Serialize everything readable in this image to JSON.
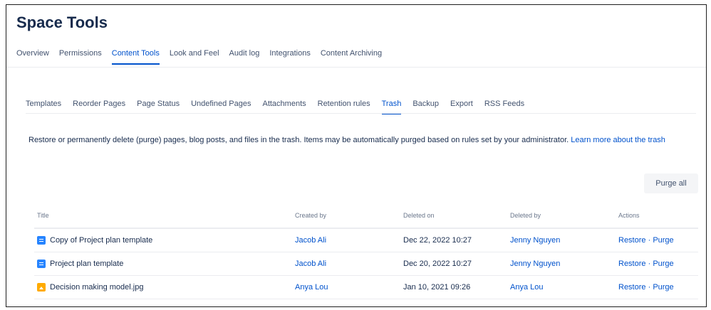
{
  "page": {
    "title": "Space Tools"
  },
  "top_tabs": [
    {
      "label": "Overview",
      "active": false
    },
    {
      "label": "Permissions",
      "active": false
    },
    {
      "label": "Content Tools",
      "active": true
    },
    {
      "label": "Look and Feel",
      "active": false
    },
    {
      "label": "Audit log",
      "active": false
    },
    {
      "label": "Integrations",
      "active": false
    },
    {
      "label": "Content Archiving",
      "active": false
    }
  ],
  "sub_tabs": [
    {
      "label": "Templates",
      "active": false
    },
    {
      "label": "Reorder Pages",
      "active": false
    },
    {
      "label": "Page Status",
      "active": false
    },
    {
      "label": "Undefined Pages",
      "active": false
    },
    {
      "label": "Attachments",
      "active": false
    },
    {
      "label": "Retention rules",
      "active": false
    },
    {
      "label": "Trash",
      "active": true
    },
    {
      "label": "Backup",
      "active": false
    },
    {
      "label": "Export",
      "active": false
    },
    {
      "label": "RSS Feeds",
      "active": false
    }
  ],
  "description": {
    "text": "Restore or permanently delete (purge) pages, blog posts, and files in the trash. Items may be automatically purged based on rules set by your administrator. ",
    "link": "Learn more about the trash"
  },
  "purge_all_label": "Purge all",
  "table": {
    "headers": {
      "title": "Title",
      "created_by": "Created by",
      "deleted_on": "Deleted on",
      "deleted_by": "Deleted by",
      "actions": "Actions"
    },
    "rows": [
      {
        "icon": "page-icon",
        "title": "Copy of Project plan template",
        "created_by": "Jacob Ali",
        "deleted_on": "Dec 22, 2022 10:27",
        "deleted_by": "Jenny Nguyen",
        "restore": "Restore",
        "sep": " · ",
        "purge": "Purge"
      },
      {
        "icon": "page-icon",
        "title": "Project plan template",
        "created_by": "Jacob Ali",
        "deleted_on": "Dec 20, 2022 10:27",
        "deleted_by": "Jenny Nguyen",
        "restore": "Restore",
        "sep": " · ",
        "purge": "Purge"
      },
      {
        "icon": "image-icon",
        "title": "Decision making model.jpg",
        "created_by": "Anya Lou",
        "deleted_on": "Jan 10, 2021 09:26",
        "deleted_by": "Anya Lou",
        "restore": "Restore",
        "sep": " · ",
        "purge": "Purge"
      }
    ]
  },
  "colors": {
    "accent": "#0052cc",
    "page_icon": "#2684ff",
    "image_icon": "#ffab00"
  }
}
